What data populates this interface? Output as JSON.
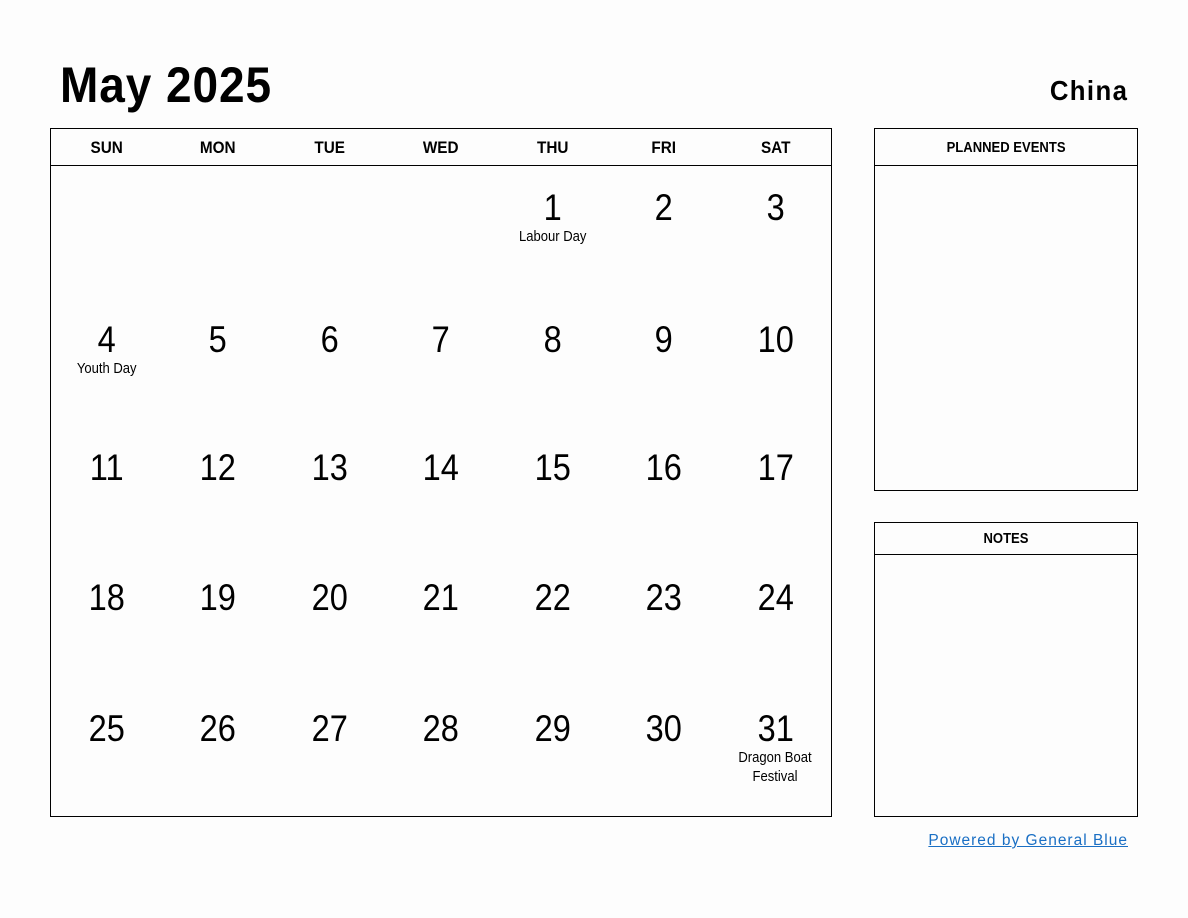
{
  "header": {
    "title": "May 2025",
    "country": "China"
  },
  "weekdays": [
    "SUN",
    "MON",
    "TUE",
    "WED",
    "THU",
    "FRI",
    "SAT"
  ],
  "weeks": [
    [
      {
        "d": ""
      },
      {
        "d": ""
      },
      {
        "d": ""
      },
      {
        "d": ""
      },
      {
        "d": "1",
        "h": "Labour Day"
      },
      {
        "d": "2"
      },
      {
        "d": "3"
      }
    ],
    [
      {
        "d": "4",
        "h": "Youth Day"
      },
      {
        "d": "5"
      },
      {
        "d": "6"
      },
      {
        "d": "7"
      },
      {
        "d": "8"
      },
      {
        "d": "9"
      },
      {
        "d": "10"
      }
    ],
    [
      {
        "d": "11"
      },
      {
        "d": "12"
      },
      {
        "d": "13"
      },
      {
        "d": "14"
      },
      {
        "d": "15"
      },
      {
        "d": "16"
      },
      {
        "d": "17"
      }
    ],
    [
      {
        "d": "18"
      },
      {
        "d": "19"
      },
      {
        "d": "20"
      },
      {
        "d": "21"
      },
      {
        "d": "22"
      },
      {
        "d": "23"
      },
      {
        "d": "24"
      }
    ],
    [
      {
        "d": "25"
      },
      {
        "d": "26"
      },
      {
        "d": "27"
      },
      {
        "d": "28"
      },
      {
        "d": "29"
      },
      {
        "d": "30"
      },
      {
        "d": "31",
        "h": "Dragon Boat Festival"
      }
    ]
  ],
  "panels": {
    "events_title": "PLANNED EVENTS",
    "notes_title": "NOTES"
  },
  "footer": {
    "powered_by": "Powered by General Blue",
    "link_color": "#1a6fc4"
  }
}
